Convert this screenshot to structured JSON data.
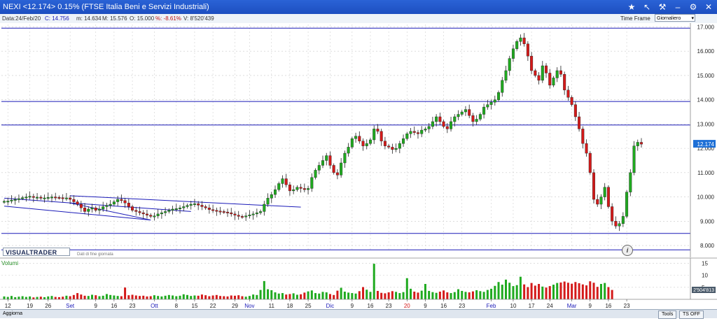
{
  "window": {
    "title": "NEXI <12.174> 0.15%  (FTSE Italia Beni e Servizi Industriali)",
    "buttons": [
      "star-icon",
      "arrow-upleft-icon",
      "wrench-icon",
      "dash-icon",
      "gear-icon",
      "close-icon"
    ]
  },
  "infobar": {
    "date": "Data:24/Feb/20",
    "close": "C: 14.756",
    "min": "m: 14.634",
    "max": "M: 15.576",
    "open": "O: 15.000",
    "var": "%: -8.61%",
    "volume": "V: 8'520'439"
  },
  "timeframe": {
    "label": "Time Frame",
    "value": "Giornaliero"
  },
  "chart_data": {
    "type": "candlestick",
    "price_ticks": [
      "17.000",
      "16.000",
      "15.000",
      "14.000",
      "13.000",
      "12.000",
      "11.000",
      "10.000",
      "9.000",
      "8.000"
    ],
    "price_range": [
      7.8,
      17.1
    ],
    "last_price_label": "12.174",
    "horizontal_levels": [
      16.95,
      13.93,
      12.96,
      8.5,
      7.82
    ],
    "volume_ticks": [
      "15",
      "10",
      "5"
    ],
    "volume_label": "Volumi",
    "volume_side_label": "2'504'813",
    "x_labels": [
      {
        "text": "12",
        "i": 1,
        "red": false
      },
      {
        "text": "19",
        "i": 7,
        "red": false
      },
      {
        "text": "26",
        "i": 12,
        "red": false
      },
      {
        "text": "Set",
        "i": 18,
        "red": false,
        "blue": true
      },
      {
        "text": "9",
        "i": 25,
        "red": false
      },
      {
        "text": "16",
        "i": 30,
        "red": false
      },
      {
        "text": "23",
        "i": 35,
        "red": false
      },
      {
        "text": "Ott",
        "i": 41,
        "red": false,
        "blue": true
      },
      {
        "text": "8",
        "i": 47,
        "red": false
      },
      {
        "text": "15",
        "i": 52,
        "red": false
      },
      {
        "text": "22",
        "i": 57,
        "red": false
      },
      {
        "text": "29",
        "i": 63,
        "red": false
      },
      {
        "text": "Nov",
        "i": 67,
        "red": false,
        "blue": true
      },
      {
        "text": "11",
        "i": 73,
        "red": false
      },
      {
        "text": "18",
        "i": 78,
        "red": false
      },
      {
        "text": "25",
        "i": 83,
        "red": false
      },
      {
        "text": "Dic",
        "i": 89,
        "red": false,
        "blue": true
      },
      {
        "text": "9",
        "i": 95,
        "red": false
      },
      {
        "text": "16",
        "i": 100,
        "red": false
      },
      {
        "text": "23",
        "i": 105,
        "red": false
      },
      {
        "text": "20",
        "i": 110,
        "red": true
      },
      {
        "text": "9",
        "i": 115,
        "red": false
      },
      {
        "text": "16",
        "i": 120,
        "red": false
      },
      {
        "text": "23",
        "i": 125,
        "red": false
      },
      {
        "text": "Feb",
        "i": 133,
        "red": false,
        "blue": true
      },
      {
        "text": "10",
        "i": 139,
        "red": false
      },
      {
        "text": "17",
        "i": 144,
        "red": false
      },
      {
        "text": "24",
        "i": 149,
        "red": false
      },
      {
        "text": "Mar",
        "i": 155,
        "red": false,
        "blue": true
      },
      {
        "text": "9",
        "i": 160,
        "red": false
      },
      {
        "text": "16",
        "i": 165,
        "red": false
      },
      {
        "text": "23",
        "i": 170,
        "red": false
      }
    ],
    "closes": [
      9.82,
      9.83,
      9.87,
      9.9,
      9.93,
      9.97,
      10,
      10.03,
      9.98,
      9.99,
      9.95,
      9.96,
      9.98,
      10,
      9.99,
      9.97,
      9.95,
      9.96,
      9.9,
      9.8,
      9.7,
      9.55,
      9.4,
      9.5,
      9.55,
      9.45,
      9.5,
      9.6,
      9.65,
      9.7,
      9.8,
      9.9,
      9.85,
      9.75,
      9.6,
      9.45,
      9.4,
      9.35,
      9.3,
      9.25,
      9.2,
      9.22,
      9.3,
      9.35,
      9.4,
      9.45,
      9.5,
      9.52,
      9.55,
      9.6,
      9.65,
      9.7,
      9.72,
      9.66,
      9.6,
      9.55,
      9.48,
      9.45,
      9.42,
      9.4,
      9.38,
      9.35,
      9.3,
      9.25,
      9.2,
      9.18,
      9.22,
      9.26,
      9.3,
      9.35,
      9.4,
      9.7,
      9.95,
      10.1,
      10.3,
      10.55,
      10.75,
      10.5,
      10.25,
      10.3,
      10.4,
      10.35,
      10.3,
      10.35,
      10.8,
      11.1,
      11.3,
      11.5,
      11.7,
      11.3,
      11,
      10.9,
      11.4,
      11.8,
      12.05,
      12.4,
      12.5,
      12.3,
      12.1,
      12.2,
      12.35,
      12.8,
      12.7,
      12.3,
      12.1,
      12.05,
      11.95,
      12,
      12.2,
      12.4,
      12.6,
      12.7,
      12.65,
      12.6,
      12.75,
      12.8,
      12.9,
      13.1,
      13.3,
      13.1,
      12.9,
      12.8,
      13.1,
      13.3,
      13.4,
      13.5,
      13.6,
      13.35,
      13.1,
      13.2,
      13.4,
      13.7,
      13.8,
      13.9,
      14,
      14.3,
      14.8,
      15.2,
      15.7,
      16.1,
      16.4,
      16.55,
      16.3,
      15.8,
      15.2,
      15,
      14.8,
      15.4,
      15.1,
      14.6,
      14.9,
      15.2,
      15.05,
      14.4,
      14.1,
      13.8,
      13.3,
      12.8,
      12.2,
      11.8,
      11,
      9.9,
      9.7,
      10,
      10.4,
      9.6,
      9,
      8.8,
      8.9,
      9.2,
      10.2,
      11,
      12.1,
      12.25,
      12.174
    ],
    "opens": [
      9.8,
      9.82,
      9.84,
      9.88,
      9.9,
      9.95,
      9.98,
      10,
      10.02,
      9.98,
      9.99,
      9.94,
      9.96,
      9.98,
      10,
      9.98,
      9.97,
      9.95,
      9.96,
      9.9,
      9.8,
      9.7,
      9.55,
      9.4,
      9.5,
      9.55,
      9.45,
      9.5,
      9.6,
      9.65,
      9.7,
      9.8,
      9.9,
      9.85,
      9.75,
      9.6,
      9.45,
      9.4,
      9.35,
      9.3,
      9.25,
      9.2,
      9.22,
      9.3,
      9.35,
      9.4,
      9.45,
      9.5,
      9.52,
      9.55,
      9.6,
      9.65,
      9.7,
      9.72,
      9.66,
      9.6,
      9.55,
      9.48,
      9.45,
      9.42,
      9.4,
      9.38,
      9.35,
      9.3,
      9.25,
      9.2,
      9.18,
      9.22,
      9.26,
      9.3,
      9.35,
      9.4,
      9.7,
      9.95,
      10.1,
      10.3,
      10.55,
      10.75,
      10.5,
      10.25,
      10.3,
      10.4,
      10.35,
      10.3,
      10.35,
      10.8,
      11.1,
      11.3,
      11.5,
      11.7,
      11.3,
      11,
      10.9,
      11.4,
      11.8,
      12.05,
      12.4,
      12.5,
      12.3,
      12.1,
      12.2,
      12.35,
      12.8,
      12.7,
      12.3,
      12.1,
      12.05,
      11.95,
      12,
      12.2,
      12.4,
      12.6,
      12.7,
      12.65,
      12.6,
      12.75,
      12.8,
      12.9,
      13.1,
      13.3,
      13.1,
      12.9,
      12.8,
      13.1,
      13.3,
      13.4,
      13.5,
      13.6,
      13.35,
      13.1,
      13.2,
      13.4,
      13.7,
      13.8,
      13.9,
      14,
      14.3,
      14.8,
      15.2,
      15.7,
      16.1,
      16.4,
      16.55,
      16.3,
      15.8,
      15.2,
      15,
      14.8,
      15.4,
      15.1,
      14.6,
      14.9,
      15.2,
      15.05,
      14.4,
      14.1,
      13.8,
      13.3,
      12.8,
      12.2,
      11.8,
      11,
      9.9,
      9.7,
      10,
      10.4,
      9.6,
      9,
      8.8,
      8.9,
      9.2,
      10.2,
      11,
      12.1,
      12.25
    ],
    "volumes": [
      1.2,
      1,
      1.4,
      0.9,
      1.1,
      1.3,
      1,
      1.2,
      0.8,
      1,
      1.1,
      0.9,
      1.2,
      1.4,
      1,
      0.9,
      1.1,
      1.5,
      1.3,
      1.8,
      2.6,
      2,
      1.5,
      1.4,
      1.9,
      1.7,
      1.3,
      1.5,
      2.2,
      1.8,
      1.6,
      1.4,
      1.3,
      4.9,
      1.7,
      1.9,
      1.6,
      1.4,
      1.5,
      1.2,
      1.3,
      1.7,
      1.4,
      1.2,
      1.5,
      1.8,
      1.6,
      1.3,
      1.5,
      2.1,
      1.8,
      1.4,
      1.6,
      1.5,
      2,
      1.7,
      1.3,
      1.6,
      1.8,
      1.4,
      1.3,
      1.2,
      1.6,
      1.5,
      1.7,
      1.3,
      1.1,
      1.4,
      2,
      1.8,
      3.9,
      7.6,
      4.2,
      3.8,
      2.9,
      2.4,
      2.6,
      2,
      2.2,
      2.5,
      1.9,
      2.1,
      2.8,
      3.3,
      3.7,
      2.6,
      2.4,
      3.1,
      2.9,
      2.2,
      1.8,
      3.6,
      4.8,
      3.2,
      2.8,
      2.6,
      2.4,
      3.4,
      5.1,
      4,
      3.1,
      14.8,
      3.5,
      2.7,
      2.5,
      2.9,
      3.4,
      3.1,
      2.6,
      3,
      8.8,
      4.4,
      3.2,
      2.8,
      3.6,
      6.4,
      3.5,
      3,
      2.7,
      3.2,
      3.7,
      2.9,
      2.6,
      3,
      4.2,
      3.5,
      3.1,
      2.9,
      3.3,
      3.8,
      3.4,
      3.1,
      3.9,
      4.4,
      5.6,
      7.2,
      6.1,
      8.2,
      6.9,
      5.5,
      5.9,
      9.4,
      6.2,
      5.1,
      6.8,
      5.7,
      6.4,
      5.3,
      4.9,
      5.5,
      6.1,
      6.8,
      7,
      7.4,
      6.9,
      6.5,
      7.2,
      6.7,
      6.2,
      5.8,
      7.5,
      6.9,
      5.2,
      6.4,
      6.8,
      5.1,
      3.9
    ],
    "channel": [
      {
        "from": [
          0,
          9.95
        ],
        "to": [
          51,
          9.4
        ]
      },
      {
        "from": [
          0,
          9.62
        ],
        "to": [
          40,
          9.05
        ]
      },
      {
        "from": [
          18,
          10.05
        ],
        "to": [
          81,
          9.58
        ]
      },
      {
        "from": [
          18,
          9.75
        ],
        "to": [
          40,
          9.05
        ]
      }
    ]
  },
  "overlay": {
    "watermark": "VISUALTRADER",
    "subtitle": "Dati di fine giornata",
    "info_icon": "i"
  },
  "bottombar": {
    "left": "Aggiorna",
    "tools": "Tools",
    "ts_off": "TS OFF"
  },
  "colors": {
    "up": "#1faa1f",
    "down": "#d41a1a",
    "level": "#1a1ab8",
    "titlebar": "#1d4fc0",
    "last_price": "#1d6fd6"
  }
}
